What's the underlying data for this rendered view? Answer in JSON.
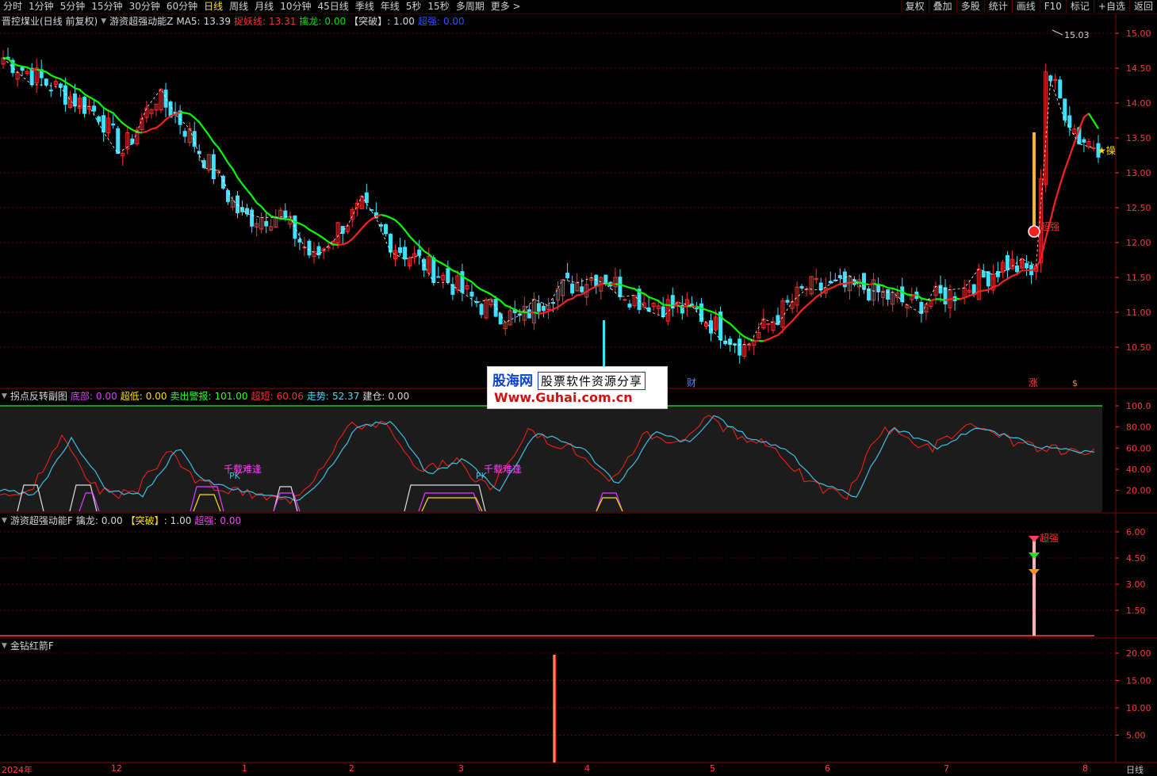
{
  "toolbar": {
    "left": [
      "分时",
      "1分钟",
      "5分钟",
      "15分钟",
      "30分钟",
      "60分钟",
      "日线",
      "周线",
      "月线",
      "10分钟",
      "45日线",
      "季线",
      "年线",
      "5秒",
      "15秒",
      "多周期",
      "更多 >"
    ],
    "active_index": 6,
    "right": [
      "复权",
      "叠加",
      "多股",
      "统计",
      "画线",
      "F10",
      "标记",
      "+自选",
      "返回"
    ]
  },
  "main_panel": {
    "stock": "晋控煤业(日线 前复权)",
    "indicator": "游资超强动能Z",
    "ma5_label": "MA5:",
    "ma5_value": "13.39",
    "tiyao_label": "捉妖线:",
    "tiyao_value": "13.31",
    "qinlong_label": "擒龙:",
    "qinlong_value": "0.00",
    "tupo_label": "【突破】:",
    "tupo_value": "1.00",
    "chaoqiang_label": "超强:",
    "chaoqiang_value": "0.00",
    "y_ticks": [
      "15.00",
      "14.50",
      "14.00",
      "13.50",
      "13.00",
      "12.50",
      "12.00",
      "11.50",
      "11.00",
      "10.50"
    ],
    "high_label": "15.03",
    "signal_label": "超强",
    "caozuo_label": "★操",
    "cai_label": "财",
    "zhang_label": "涨",
    "s_label": "$"
  },
  "panel2": {
    "name": "拐点反转副图",
    "dibu_label": "底部:",
    "dibu_value": "0.00",
    "chaodi_label": "超低:",
    "chaodi_value": "0.00",
    "maichu_label": "卖出警报:",
    "maichu_value": "101.00",
    "chaoduan_label": "超短:",
    "chaoduan_value": "60.06",
    "zoushi_label": "走势:",
    "zoushi_value": "52.37",
    "jiancang_label": "建仓:",
    "jiancang_value": "0.00",
    "y_ticks": [
      "100.0",
      "80.00",
      "60.00",
      "40.00",
      "20.00"
    ],
    "annot1": "千载难逢",
    "annot2": "千载难逢",
    "pk": "PK"
  },
  "panel3": {
    "name": "游资超强动能F",
    "qinlong_label": "擒龙:",
    "qinlong_value": "0.00",
    "tupo_label": "【突破】:",
    "tupo_value": "1.00",
    "chaoqiang_label": "超强:",
    "chaoqiang_value": "0.00",
    "y_ticks": [
      "6.00",
      "4.50",
      "3.00",
      "1.50"
    ],
    "signal_label": "超强"
  },
  "panel4": {
    "name": "金钻红箭F",
    "y_ticks": [
      "20.00",
      "15.00",
      "10.00",
      "5.00"
    ]
  },
  "date_axis": [
    "2024年",
    "12",
    "1",
    "2",
    "3",
    "4",
    "5",
    "6",
    "7",
    "8"
  ],
  "period_label": "日线",
  "watermark": {
    "site_cn": "股海网",
    "slogan": "股票软件资源分享",
    "url": "Www.Guhai.com.cn"
  },
  "colors": {
    "up": "#ff3030",
    "down": "#40e0ff",
    "ma_up": "#ff2020",
    "ma_down": "#00ff00",
    "grid": "#6a0000"
  }
}
